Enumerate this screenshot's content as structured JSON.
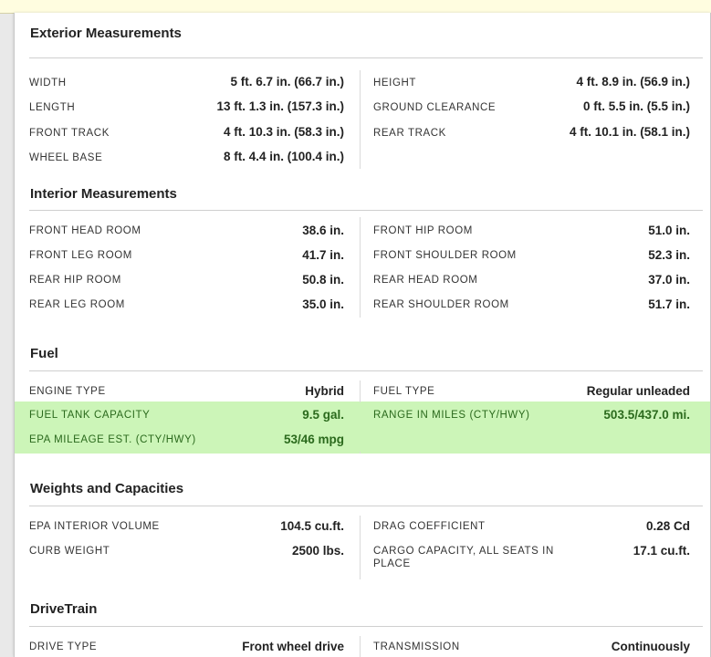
{
  "colors": {
    "highlight": "#ccf5b8",
    "highlight_text": "#2b6a1d",
    "banner": "#fffde0"
  },
  "sections": {
    "exterior": {
      "title": "Exterior Measurements",
      "rows": [
        {
          "l1": "WIDTH",
          "v1": "5 ft. 6.7 in. (66.7 in.)",
          "l2": "HEIGHT",
          "v2": "4 ft. 8.9 in. (56.9 in.)"
        },
        {
          "l1": "LENGTH",
          "v1": "13 ft. 1.3 in. (157.3 in.)",
          "l2": "GROUND CLEARANCE",
          "v2": "0 ft. 5.5 in. (5.5 in.)"
        },
        {
          "l1": "FRONT TRACK",
          "v1": "4 ft. 10.3 in. (58.3 in.)",
          "l2": "REAR TRACK",
          "v2": "4 ft. 10.1 in. (58.1 in.)"
        },
        {
          "l1": "WHEEL BASE",
          "v1": "8 ft. 4.4 in. (100.4 in.)",
          "l2": "",
          "v2": ""
        }
      ]
    },
    "interior": {
      "title": "Interior Measurements",
      "rows": [
        {
          "l1": "FRONT HEAD ROOM",
          "v1": "38.6 in.",
          "l2": "FRONT HIP ROOM",
          "v2": "51.0 in."
        },
        {
          "l1": "FRONT LEG ROOM",
          "v1": "41.7 in.",
          "l2": "FRONT SHOULDER ROOM",
          "v2": "52.3 in."
        },
        {
          "l1": "REAR HIP ROOM",
          "v1": "50.8 in.",
          "l2": "REAR HEAD ROOM",
          "v2": "37.0 in."
        },
        {
          "l1": "REAR LEG ROOM",
          "v1": "35.0 in.",
          "l2": "REAR SHOULDER ROOM",
          "v2": "51.7 in."
        }
      ]
    },
    "fuel": {
      "title": "Fuel",
      "rows": [
        {
          "l1": "ENGINE TYPE",
          "v1": "Hybrid",
          "l2": "FUEL TYPE",
          "v2": "Regular unleaded"
        },
        {
          "l1": "FUEL TANK CAPACITY",
          "v1": "9.5 gal.",
          "l2": "RANGE IN MILES (CTY/HWY)",
          "v2": "503.5/437.0 mi."
        },
        {
          "l1": "EPA MILEAGE EST. (CTY/HWY)",
          "v1": "53/46 mpg",
          "l2": "",
          "v2": ""
        }
      ]
    },
    "weights": {
      "title": "Weights and Capacities",
      "rows": [
        {
          "l1": "EPA INTERIOR VOLUME",
          "v1": "104.5 cu.ft.",
          "l2": "DRAG COEFFICIENT",
          "v2": "0.28 Cd"
        },
        {
          "l1": "CURB WEIGHT",
          "v1": "2500 lbs.",
          "l2": "CARGO CAPACITY, ALL SEATS IN PLACE",
          "v2": "17.1 cu.ft."
        }
      ]
    },
    "drivetrain": {
      "title": "DriveTrain",
      "rows": [
        {
          "l1": "DRIVE TYPE",
          "v1": "Front wheel drive",
          "l2": "TRANSMISSION",
          "v2": "Continuously"
        }
      ]
    }
  }
}
